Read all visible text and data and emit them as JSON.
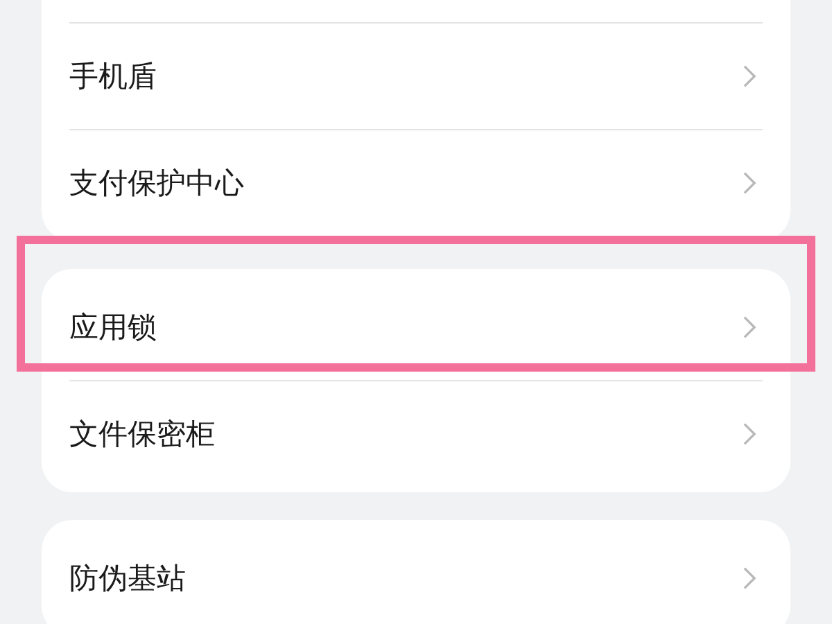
{
  "groups": [
    {
      "items": [
        {
          "label": "手机盾",
          "highlighted": false
        },
        {
          "label": "支付保护中心",
          "highlighted": false
        }
      ]
    },
    {
      "items": [
        {
          "label": "应用锁",
          "highlighted": true
        },
        {
          "label": "文件保密柜",
          "highlighted": false
        }
      ]
    },
    {
      "items": [
        {
          "label": "防伪基站",
          "highlighted": false
        }
      ]
    }
  ]
}
